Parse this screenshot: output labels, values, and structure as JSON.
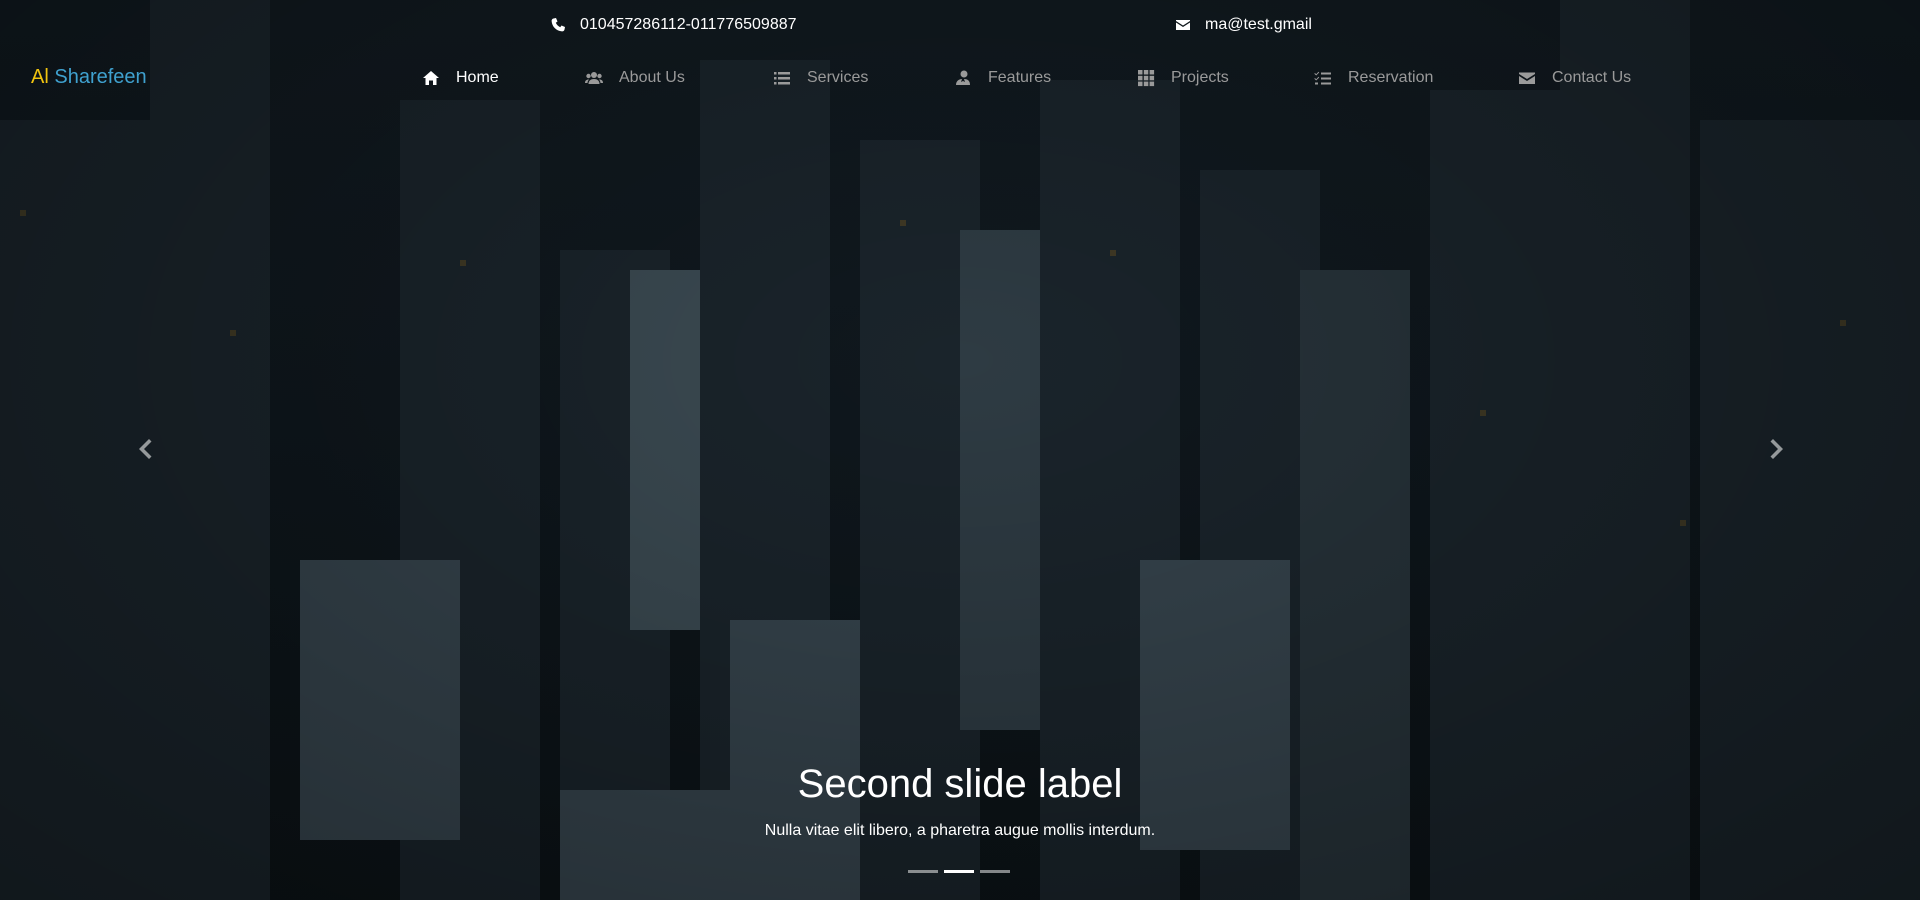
{
  "contact": {
    "phone": "010457286112-011776509887",
    "email": "ma@test.gmail"
  },
  "brand": {
    "first": "Al",
    "second": "Sharefeen"
  },
  "nav": [
    {
      "label": "Home",
      "icon": "home-icon",
      "active": true
    },
    {
      "label": "About Us",
      "icon": "users-icon",
      "active": false
    },
    {
      "label": "Services",
      "icon": "list-icon",
      "active": false
    },
    {
      "label": "Features",
      "icon": "user-tie-icon",
      "active": false
    },
    {
      "label": "Projects",
      "icon": "grid-icon",
      "active": false
    },
    {
      "label": "Reservation",
      "icon": "checklist-icon",
      "active": false
    },
    {
      "label": "Contact Us",
      "icon": "envelope-icon",
      "active": false
    }
  ],
  "carousel": {
    "title": "Second slide label",
    "text": "Nulla vitae elit libero, a pharetra augue mollis interdum.",
    "active_index": 1,
    "slide_count": 3
  },
  "colors": {
    "brand_first": "#f1c40f",
    "brand_second": "#3fa1cf",
    "nav_text": "#9a9a9a",
    "nav_active": "#ffffff"
  }
}
